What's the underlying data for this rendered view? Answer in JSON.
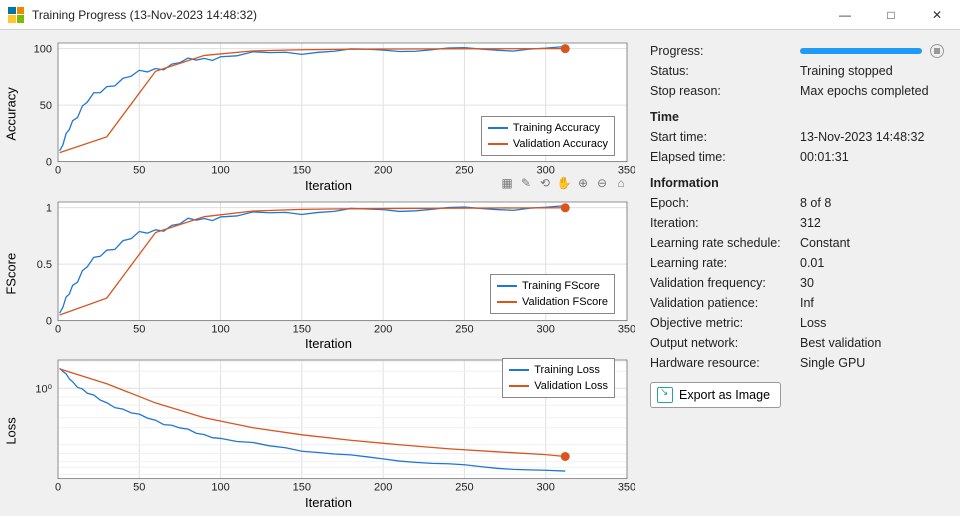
{
  "window": {
    "title": "Training Progress (13-Nov-2023 14:48:32)"
  },
  "sidebar": {
    "progress_label": "Progress:",
    "progress_pct": 100,
    "status_label": "Status:",
    "status_value": "Training stopped",
    "stop_reason_label": "Stop reason:",
    "stop_reason_value": "Max epochs completed",
    "time_header": "Time",
    "start_label": "Start time:",
    "start_value": "13-Nov-2023 14:48:32",
    "elapsed_label": "Elapsed time:",
    "elapsed_value": "00:01:31",
    "info_header": "Information",
    "epoch_label": "Epoch:",
    "epoch_value": "8 of 8",
    "iter_label": "Iteration:",
    "iter_value": "312",
    "lrsched_label": "Learning rate schedule:",
    "lrsched_value": "Constant",
    "lr_label": "Learning rate:",
    "lr_value": "0.01",
    "valfreq_label": "Validation frequency:",
    "valfreq_value": "30",
    "valpat_label": "Validation patience:",
    "valpat_value": "Inf",
    "obj_label": "Objective metric:",
    "obj_value": "Loss",
    "outnet_label": "Output network:",
    "outnet_value": "Best validation",
    "hw_label": "Hardware resource:",
    "hw_value": "Single GPU",
    "export_button": "Export as Image"
  },
  "axis_common": {
    "xlabel": "Iteration",
    "xticks": [
      0,
      50,
      100,
      150,
      200,
      250,
      300,
      350
    ],
    "xlim": [
      0,
      350
    ]
  },
  "charts": [
    {
      "id": "accuracy",
      "ylabel": "Accuracy",
      "yticks": [
        0,
        50,
        100
      ],
      "legend": {
        "train": "Training Accuracy",
        "val": "Validation Accuracy"
      },
      "legend_pos": "br"
    },
    {
      "id": "fscore",
      "ylabel": "FScore",
      "yticks": [
        0,
        0.5,
        1
      ],
      "legend": {
        "train": "Training FScore",
        "val": "Validation FScore"
      },
      "legend_pos": "br",
      "show_toolbar": true
    },
    {
      "id": "loss",
      "ylabel": "Loss",
      "yticks_log": [
        "10⁰"
      ],
      "legend": {
        "train": "Training Loss",
        "val": "Validation Loss"
      },
      "legend_pos": "tr"
    }
  ],
  "chart_data": [
    {
      "type": "line",
      "title": "Accuracy",
      "xlabel": "Iteration",
      "ylabel": "Accuracy",
      "xlim": [
        0,
        350
      ],
      "ylim": [
        0,
        105
      ],
      "series": [
        {
          "name": "Training Accuracy",
          "x": [
            1,
            3,
            5,
            7,
            9,
            12,
            15,
            18,
            22,
            26,
            30,
            35,
            40,
            45,
            50,
            55,
            60,
            65,
            70,
            75,
            80,
            85,
            90,
            95,
            100,
            110,
            120,
            130,
            140,
            150,
            160,
            170,
            180,
            190,
            200,
            210,
            220,
            230,
            240,
            250,
            260,
            270,
            280,
            290,
            300,
            312
          ],
          "y": [
            8,
            15,
            22,
            30,
            36,
            42,
            48,
            53,
            58,
            62,
            66,
            70,
            73,
            76,
            78,
            80,
            82,
            84,
            86,
            88,
            89,
            90,
            91,
            92,
            93,
            94,
            95,
            96,
            96.5,
            97,
            97.5,
            98,
            98,
            98.5,
            98.5,
            99,
            99,
            99.2,
            99.3,
            99.4,
            99.5,
            99.6,
            99.6,
            99.7,
            99.8,
            99.9
          ]
        },
        {
          "name": "Validation Accuracy",
          "x": [
            1,
            30,
            60,
            90,
            120,
            150,
            180,
            210,
            240,
            270,
            300,
            312
          ],
          "y": [
            8,
            22,
            80,
            94,
            98,
            99,
            99.5,
            99.7,
            99.8,
            99.9,
            100,
            100
          ]
        }
      ]
    },
    {
      "type": "line",
      "title": "FScore",
      "xlabel": "Iteration",
      "ylabel": "FScore",
      "xlim": [
        0,
        350
      ],
      "ylim": [
        0,
        1.05
      ],
      "series": [
        {
          "name": "Training FScore",
          "x": [
            1,
            3,
            5,
            7,
            9,
            12,
            15,
            18,
            22,
            26,
            30,
            35,
            40,
            45,
            50,
            55,
            60,
            65,
            70,
            75,
            80,
            85,
            90,
            95,
            100,
            110,
            120,
            130,
            140,
            150,
            160,
            170,
            180,
            190,
            200,
            210,
            220,
            230,
            240,
            250,
            260,
            270,
            280,
            290,
            300,
            312
          ],
          "y": [
            0.05,
            0.12,
            0.18,
            0.25,
            0.31,
            0.37,
            0.43,
            0.48,
            0.53,
            0.58,
            0.62,
            0.66,
            0.7,
            0.73,
            0.76,
            0.78,
            0.8,
            0.82,
            0.84,
            0.86,
            0.88,
            0.89,
            0.9,
            0.91,
            0.92,
            0.93,
            0.94,
            0.95,
            0.955,
            0.96,
            0.965,
            0.97,
            0.975,
            0.978,
            0.98,
            0.982,
            0.985,
            0.987,
            0.989,
            0.99,
            0.992,
            0.993,
            0.994,
            0.996,
            0.997,
            0.998
          ]
        },
        {
          "name": "Validation FScore",
          "x": [
            1,
            30,
            60,
            90,
            120,
            150,
            180,
            210,
            240,
            270,
            300,
            312
          ],
          "y": [
            0.05,
            0.2,
            0.78,
            0.92,
            0.97,
            0.985,
            0.99,
            0.993,
            0.995,
            0.997,
            0.998,
            0.999
          ]
        }
      ]
    },
    {
      "type": "line",
      "title": "Loss",
      "xlabel": "Iteration",
      "ylabel": "Loss",
      "xlim": [
        0,
        350
      ],
      "yscale": "log",
      "ylim_log10": [
        -1.6,
        0.5
      ],
      "series": [
        {
          "name": "Training Loss",
          "x": [
            1,
            3,
            5,
            7,
            9,
            12,
            15,
            18,
            22,
            26,
            30,
            35,
            40,
            45,
            50,
            55,
            60,
            65,
            70,
            75,
            80,
            85,
            90,
            95,
            100,
            110,
            120,
            130,
            140,
            150,
            160,
            170,
            180,
            190,
            200,
            210,
            220,
            230,
            240,
            250,
            260,
            270,
            280,
            290,
            300,
            312
          ],
          "y": [
            2.2,
            2.0,
            1.7,
            1.5,
            1.3,
            1.1,
            0.95,
            0.82,
            0.72,
            0.63,
            0.55,
            0.48,
            0.42,
            0.37,
            0.33,
            0.3,
            0.27,
            0.24,
            0.22,
            0.2,
            0.18,
            0.16,
            0.15,
            0.14,
            0.13,
            0.115,
            0.105,
            0.095,
            0.088,
            0.08,
            0.074,
            0.069,
            0.064,
            0.06,
            0.056,
            0.053,
            0.05,
            0.047,
            0.045,
            0.043,
            0.041,
            0.039,
            0.038,
            0.036,
            0.035,
            0.033
          ]
        },
        {
          "name": "Validation Loss",
          "x": [
            1,
            30,
            60,
            90,
            120,
            150,
            180,
            210,
            240,
            270,
            300,
            312
          ],
          "y": [
            2.2,
            1.2,
            0.55,
            0.3,
            0.2,
            0.15,
            0.12,
            0.1,
            0.085,
            0.075,
            0.067,
            0.062
          ]
        }
      ]
    }
  ]
}
